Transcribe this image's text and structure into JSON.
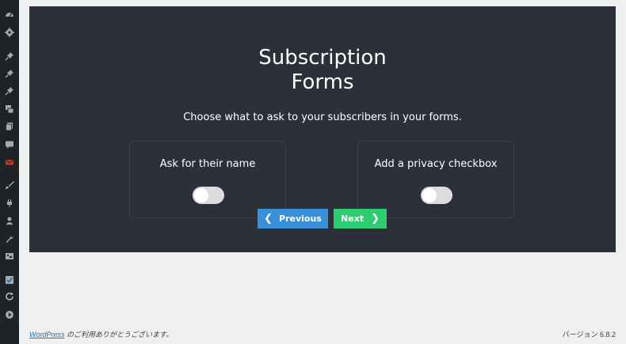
{
  "sidebar": {
    "icons": [
      "dashboard-icon",
      "gear-icon",
      "pin-icon",
      "pin-icon",
      "pin-icon",
      "media-icon",
      "pages-icon",
      "comments-icon",
      "mail-icon",
      "brush-icon",
      "plugin-icon",
      "user-icon",
      "wrench-icon",
      "settings-icon",
      "checkbox-icon",
      "refresh-icon",
      "play-icon"
    ]
  },
  "panel": {
    "title_line1": "Subscription",
    "title_line2": "Forms",
    "subtitle": "Choose what to ask to your subscribers in your forms.",
    "cards": [
      {
        "label": "Ask for their name",
        "enabled": false
      },
      {
        "label": "Add a privacy checkbox",
        "enabled": false
      }
    ],
    "prev_label": "Previous",
    "next_label": "Next"
  },
  "footer": {
    "link_text": "WordPress",
    "thanks_text": " のご利用ありがとうございます。",
    "version_text": "バージョン 6.8.2"
  },
  "colors": {
    "panel_bg": "#2c3039",
    "prev_button": "#3a8fd9",
    "next_button": "#2ecc71",
    "sidebar_bg": "#1d2327"
  }
}
